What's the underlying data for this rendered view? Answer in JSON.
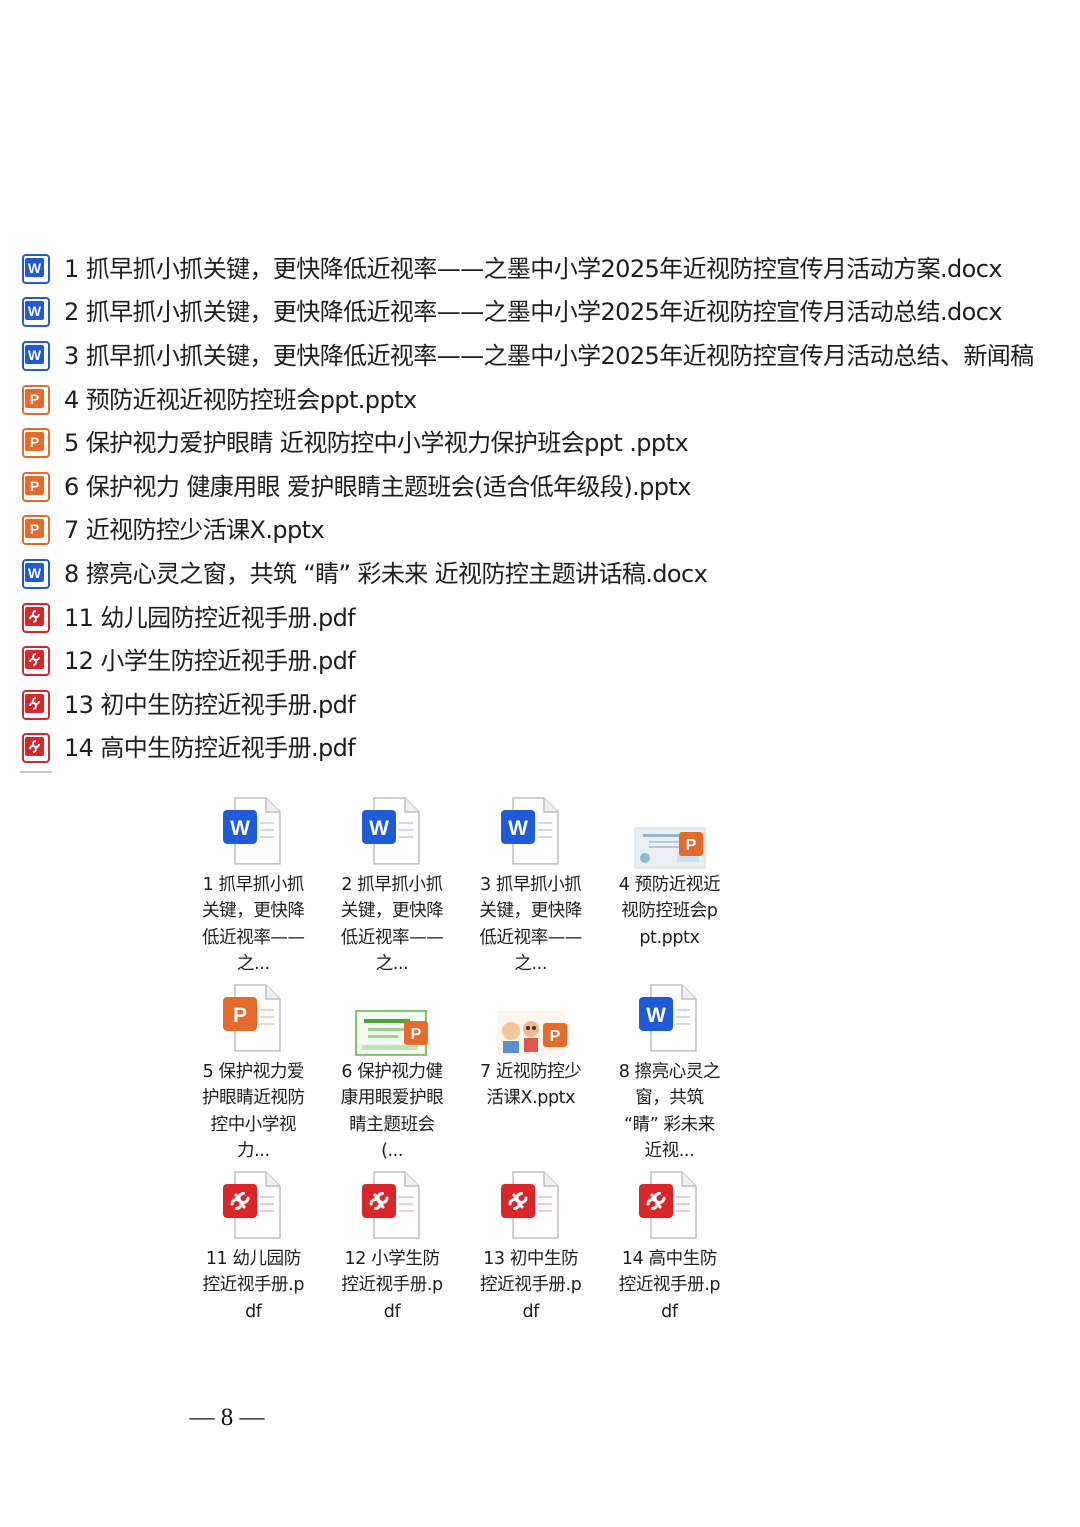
{
  "list_view": {
    "items": [
      {
        "type": "word",
        "name": "1 抓早抓小抓关键，更快降低近视率——之墨中小学2025年近视防控宣传月活动方案.docx"
      },
      {
        "type": "word",
        "name": "2 抓早抓小抓关键，更快降低近视率——之墨中小学2025年近视防控宣传月活动总结.docx"
      },
      {
        "type": "word",
        "name": "3 抓早抓小抓关键，更快降低近视率——之墨中小学2025年近视防控宣传月活动总结、新闻稿"
      },
      {
        "type": "ppt",
        "name": "4 预防近视近视防控班会ppt.pptx"
      },
      {
        "type": "ppt",
        "name": "5 保护视力爱护眼睛 近视防控中小学视力保护班会ppt .pptx"
      },
      {
        "type": "ppt",
        "name": "6 保护视力 健康用眼 爱护眼睛主题班会(适合低年级段).pptx"
      },
      {
        "type": "ppt",
        "name": "7 近视防控少活课X.pptx"
      },
      {
        "type": "word",
        "name": "8 擦亮心灵之窗，共筑 “睛” 彩未来 近视防控主题讲话稿.docx"
      },
      {
        "type": "pdf",
        "name": "11 幼儿园防控近视手册.pdf"
      },
      {
        "type": "pdf",
        "name": "12 小学生防控近视手册.pdf"
      },
      {
        "type": "pdf",
        "name": "13 初中生防控近视手册.pdf"
      },
      {
        "type": "pdf",
        "name": "14 高中生防控近视手册.pdf"
      }
    ]
  },
  "icon_view": {
    "items": [
      {
        "type": "word",
        "label": "1 抓早抓小抓关键，更快降低近视率——之..."
      },
      {
        "type": "word",
        "label": "2 抓早抓小抓关键，更快降低近视率——之..."
      },
      {
        "type": "word",
        "label": "3 抓早抓小抓关键，更快降低近视率——之..."
      },
      {
        "type": "ppt-thumb",
        "label": "4 预防近视近视防控班会ppt.pptx"
      },
      {
        "type": "ppt",
        "label": "5 保护视力爱护眼睛近视防控中小学视力..."
      },
      {
        "type": "ppt-thumb",
        "label": "6 保护视力健康用眼爱护眼睛主题班会(..."
      },
      {
        "type": "ppt-thumb",
        "label": "7 近视防控少活课X.pptx"
      },
      {
        "type": "word",
        "label": "8 擦亮心灵之窗，共筑 “睛” 彩未来 近视..."
      },
      {
        "type": "pdf",
        "label": "11 幼儿园防控近视手册.pdf"
      },
      {
        "type": "pdf",
        "label": "12 小学生防控近视手册.pdf"
      },
      {
        "type": "pdf",
        "label": "13 初中生防控近视手册.pdf"
      },
      {
        "type": "pdf",
        "label": "14 高中生防控近视手册.pdf"
      }
    ]
  },
  "footer": {
    "page_number": "— 8 —"
  },
  "colors": {
    "word": "#1f5bd6",
    "ppt": "#e66a2c",
    "pdf": "#d9262b"
  }
}
